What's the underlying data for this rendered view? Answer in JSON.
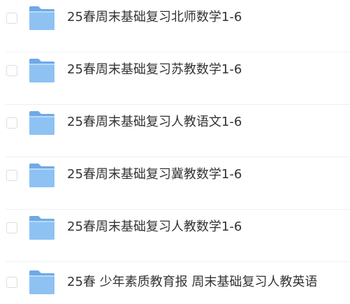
{
  "files": [
    {
      "name": "25春周末基础复习北师数学1-6",
      "icon": "folder-icon"
    },
    {
      "name": "25春周末基础复习苏教数学1-6",
      "icon": "folder-icon"
    },
    {
      "name": "25春周末基础复习人教语文1-6",
      "icon": "folder-icon"
    },
    {
      "name": "25春周末基础复习冀教数学1-6",
      "icon": "folder-icon"
    },
    {
      "name": "25春周末基础复习人教数学1-6",
      "icon": "folder-icon"
    },
    {
      "name": "25春 少年素质教育报 周末基础复习人教英语",
      "icon": "folder-icon"
    }
  ],
  "colors": {
    "folder_back": "#6fa9e6",
    "folder_front": "#8ec2f3",
    "folder_highlight": "#b7daf8",
    "text": "#333333",
    "divider": "#eef0f3"
  }
}
